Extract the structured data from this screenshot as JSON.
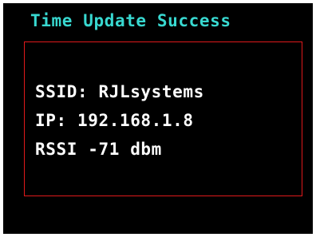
{
  "screen": {
    "title": "Time Update Success",
    "info": {
      "ssid": "SSID: RJLsystems",
      "ip": "IP: 192.168.1.8",
      "rssi": "RSSI -71 dbm"
    }
  },
  "colors": {
    "background": "#000000",
    "title": "#38d8d0",
    "text": "#ffffff",
    "box_border": "#e0191b"
  }
}
